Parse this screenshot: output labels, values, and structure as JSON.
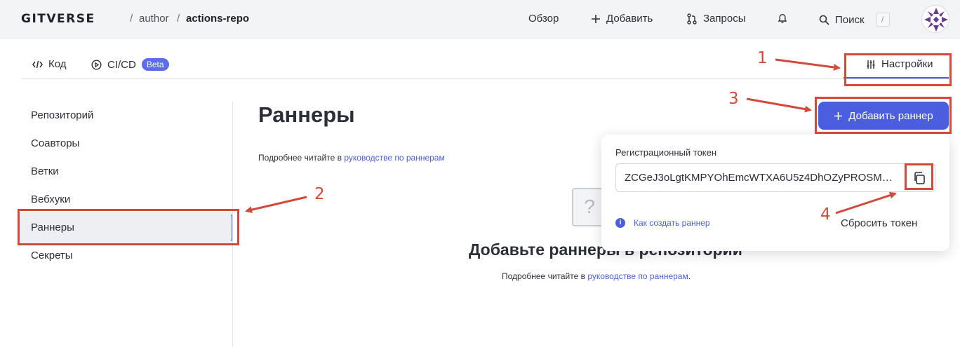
{
  "header": {
    "logo": "GITVERSE",
    "breadcrumb_sep": "/",
    "owner": "author",
    "repo": "actions-repo",
    "nav": {
      "overview": "Обзор",
      "add": "Добавить",
      "requests": "Запросы",
      "search": "Поиск",
      "search_shortcut": "/"
    }
  },
  "tabs": {
    "code": "Код",
    "cicd": "CI/CD",
    "cicd_badge": "Beta",
    "settings": "Настройки"
  },
  "sidebar": {
    "items": [
      {
        "label": "Репозиторий"
      },
      {
        "label": "Соавторы"
      },
      {
        "label": "Ветки"
      },
      {
        "label": "Вебхуки"
      },
      {
        "label": "Раннеры",
        "selected": true
      },
      {
        "label": "Секреты"
      }
    ]
  },
  "main": {
    "title": "Раннеры",
    "read_more_prefix": "Подробнее читайте в ",
    "read_more_link": "руководстве по раннерам",
    "empty_title": "Добавьте раннеры в репозитории",
    "empty_prefix": "Подробнее читайте в ",
    "empty_link": "руководстве по раннерам",
    "empty_suffix": ".",
    "add_button": "Добавить раннер"
  },
  "popover": {
    "label": "Регистрационный токен",
    "token": "ZCGeJ3oLgtKMPYOhEmcWTXA6U5z4DhOZyPROSM…",
    "how_to_link": "Как создать раннер",
    "reset_button": "Сбросить токен"
  },
  "annotations": [
    "1",
    "2",
    "3",
    "4"
  ],
  "colors": {
    "accent": "#4c5ee0",
    "annotation": "#d14a3b"
  }
}
